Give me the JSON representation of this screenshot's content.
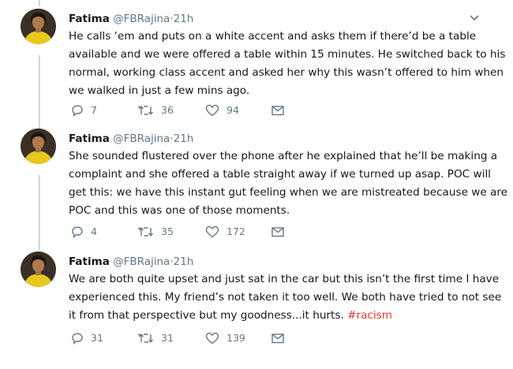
{
  "tweets": [
    {
      "name": "Fatima",
      "handle": "@FBRajina",
      "time": "·21h",
      "lines": [
        "He calls ‘em and puts on a white accent and asks them if there’d be a table",
        "available and we were offered a table within 15 minutes. He switched back to his",
        "normal, working class accent and asked her why this wasn’t offered to him when",
        "we walked in just a few mins ago."
      ],
      "replies": "7",
      "retweets": "36",
      "likes": "94"
    },
    {
      "name": "Fatima",
      "handle": "@FBRajina",
      "time": "·21h",
      "lines": [
        "She sounded flustered over the phone after he explained that he’ll be making a",
        "complaint and she offered a table straight away if we turned up asap. POC will",
        "get this: we have this instant gut feeling when we are mistreated because we are",
        "POC and this was one of those moments."
      ],
      "replies": "4",
      "retweets": "35",
      "likes": "172"
    },
    {
      "name": "Fatima",
      "handle": "@FBRajina",
      "time": "·21h",
      "lines": [
        "We are both quite upset and just sat in the car but this isn’t the first time I have",
        "experienced this. My friend’s not taken it too well. We both have tried to not see",
        "it from that perspective but my goodness...it hurts. "
      ],
      "hashtag": "#racism",
      "replies": "31",
      "retweets": "31",
      "likes": "139"
    }
  ],
  "icons": {
    "reply": "reply-icon",
    "retweet": "retweet-icon",
    "like": "like-icon",
    "message": "message-icon",
    "caret": "chevron-down-icon"
  },
  "colors": {
    "text": "#14171a",
    "secondary": "#657786",
    "hashtag": "#e0392b",
    "thread_line": "#ccd6dd"
  }
}
